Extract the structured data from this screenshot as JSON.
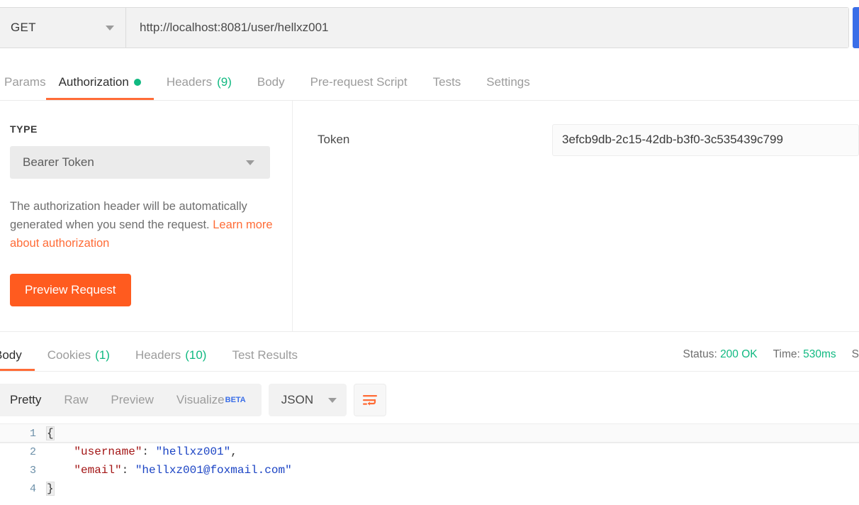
{
  "url_bar": {
    "method": "GET",
    "method_caret_icon": "chevron-down-icon",
    "url": "http://localhost:8081/user/hellxz001",
    "send_label": ""
  },
  "request_tabs": [
    {
      "label": "Params",
      "active": false,
      "dot": false,
      "count": ""
    },
    {
      "label": "Authorization",
      "active": true,
      "dot": true,
      "count": ""
    },
    {
      "label": "Headers",
      "active": false,
      "dot": false,
      "count": "(9)"
    },
    {
      "label": "Body",
      "active": false,
      "dot": false,
      "count": ""
    },
    {
      "label": "Pre-request Script",
      "active": false,
      "dot": false,
      "count": ""
    },
    {
      "label": "Tests",
      "active": false,
      "dot": false,
      "count": ""
    },
    {
      "label": "Settings",
      "active": false,
      "dot": false,
      "count": ""
    }
  ],
  "authorization": {
    "type_label": "TYPE",
    "type_value": "Bearer Token",
    "type_caret_icon": "chevron-down-icon",
    "description_prefix": "The authorization header will be automatically generated when you send the request. ",
    "description_link": "Learn more about authorization",
    "preview_button": "Preview Request",
    "token_label": "Token",
    "token_value": "3efcb9db-2c15-42db-b3f0-3c535439c799"
  },
  "response_tabs": [
    {
      "label": "Body",
      "active": true,
      "count": ""
    },
    {
      "label": "Cookies",
      "active": false,
      "count": "(1)"
    },
    {
      "label": "Headers",
      "active": false,
      "count": "(10)"
    },
    {
      "label": "Test Results",
      "active": false,
      "count": ""
    }
  ],
  "response_status": {
    "status_label": "Status:",
    "status_value": "200 OK",
    "time_label": "Time:",
    "time_value": "530ms",
    "size_label": "S"
  },
  "viewer_toolbar": {
    "modes": [
      {
        "label": "Pretty",
        "active": true,
        "beta": ""
      },
      {
        "label": "Raw",
        "active": false,
        "beta": ""
      },
      {
        "label": "Preview",
        "active": false,
        "beta": ""
      },
      {
        "label": "Visualize",
        "active": false,
        "beta": "BETA"
      }
    ],
    "format": "JSON",
    "format_caret_icon": "chevron-down-icon",
    "wrap_icon": "word-wrap-icon"
  },
  "code": {
    "lines": [
      {
        "num": "1",
        "segments": [
          {
            "text": "{",
            "type": "brace"
          }
        ]
      },
      {
        "num": "2",
        "segments": [
          {
            "text": "    ",
            "type": "plain"
          },
          {
            "text": "\"username\"",
            "type": "key"
          },
          {
            "text": ": ",
            "type": "punct"
          },
          {
            "text": "\"hellxz001\"",
            "type": "str"
          },
          {
            "text": ",",
            "type": "punct"
          }
        ]
      },
      {
        "num": "3",
        "segments": [
          {
            "text": "    ",
            "type": "plain"
          },
          {
            "text": "\"email\"",
            "type": "key"
          },
          {
            "text": ": ",
            "type": "punct"
          },
          {
            "text": "\"hellxz001@foxmail.com\"",
            "type": "str"
          }
        ]
      },
      {
        "num": "4",
        "segments": [
          {
            "text": "}",
            "type": "brace"
          }
        ]
      }
    ]
  },
  "colors": {
    "accent_orange": "#ff6c37",
    "send_blue": "#3a6ee8",
    "success_green": "#10b981",
    "json_key_red": "#a31515",
    "json_string_blue": "#1a43c4"
  }
}
